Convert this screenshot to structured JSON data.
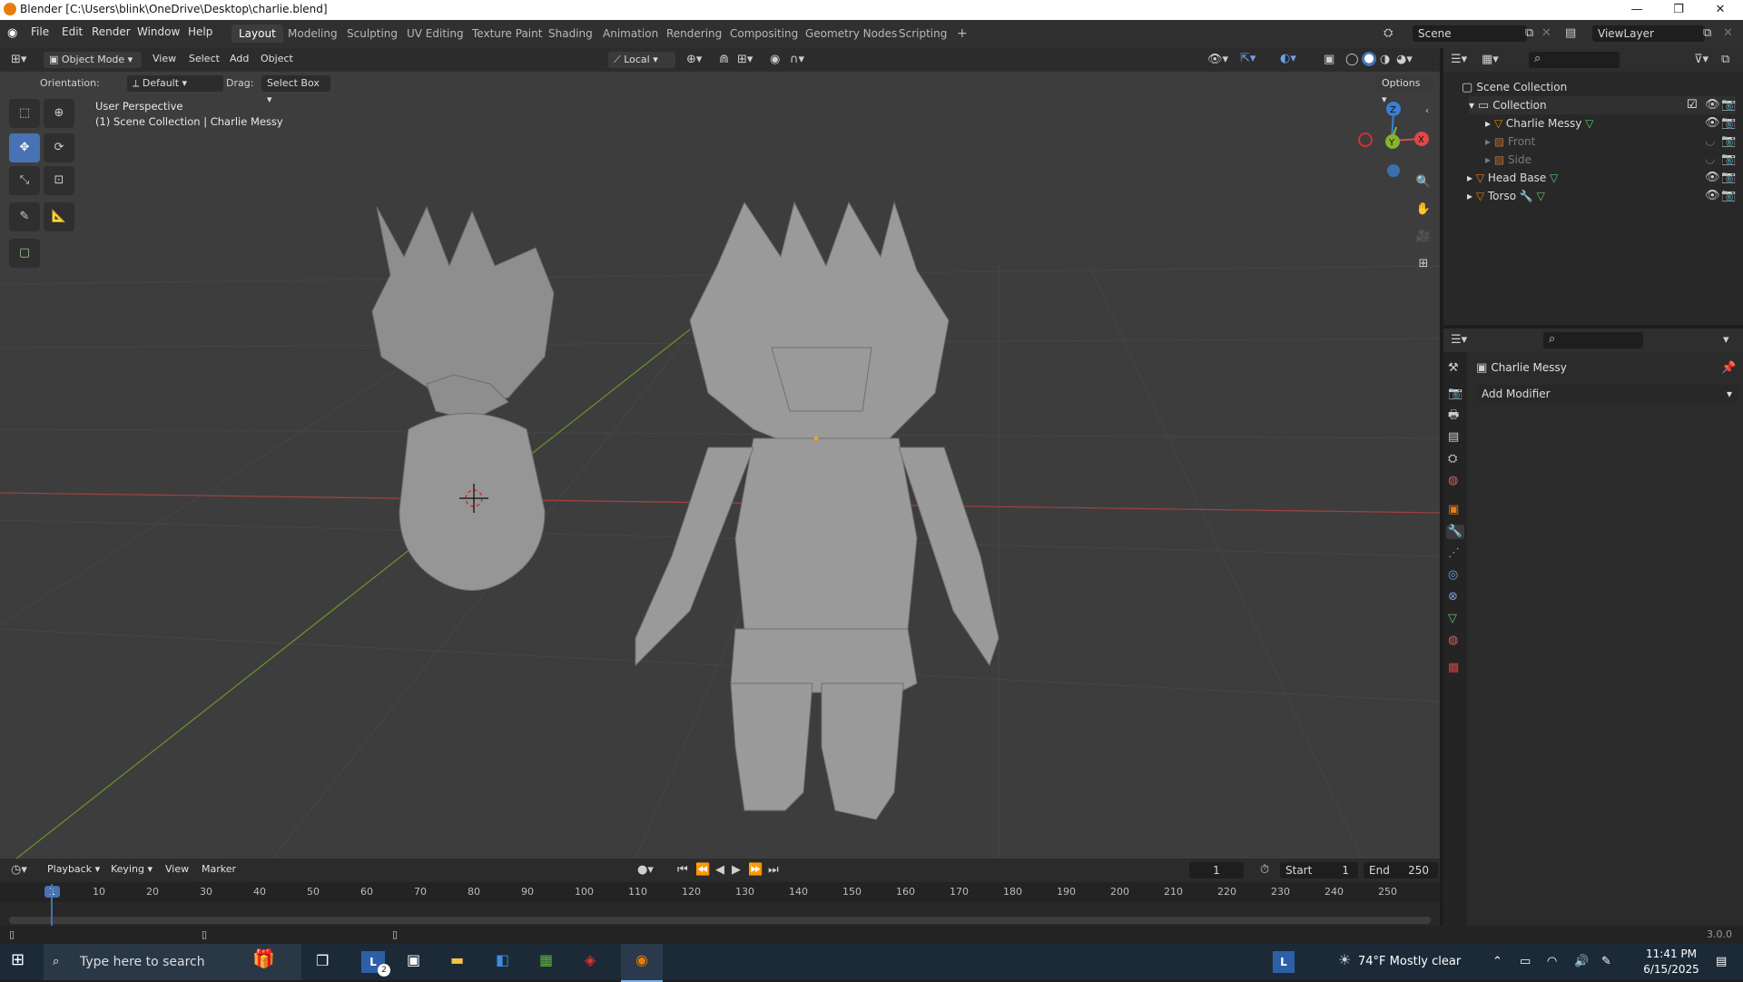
{
  "window": {
    "title": "Blender [C:\\Users\\blink\\OneDrive\\Desktop\\charlie.blend]"
  },
  "menu": [
    "File",
    "Edit",
    "Render",
    "Window",
    "Help"
  ],
  "workspaces": [
    "Layout",
    "Modeling",
    "Sculpting",
    "UV Editing",
    "Texture Paint",
    "Shading",
    "Animation",
    "Rendering",
    "Compositing",
    "Geometry Nodes",
    "Scripting",
    "+"
  ],
  "scene": {
    "name": "Scene",
    "view_layer": "ViewLayer"
  },
  "viewport_header": {
    "mode": "Object Mode",
    "menus": [
      "View",
      "Select",
      "Add",
      "Object"
    ],
    "transform_space": "Local",
    "options": "Options"
  },
  "tool_settings": {
    "orientation_label": "Orientation:",
    "orientation_value": "Default",
    "drag_label": "Drag:",
    "drag_value": "Select Box"
  },
  "overlay_text": {
    "perspective": "User Perspective",
    "collection": "(1) Scene Collection | Charlie Messy"
  },
  "gizmo": {
    "z": "Z",
    "y": "Y",
    "x": "X"
  },
  "outliner": {
    "root": "Scene Collection",
    "collection": "Collection",
    "items": [
      {
        "name": "Charlie Messy",
        "level": 2
      },
      {
        "name": "Front",
        "level": 2
      },
      {
        "name": "Side",
        "level": 2
      },
      {
        "name": "Head Base",
        "level": 1
      },
      {
        "name": "Torso",
        "level": 1
      }
    ]
  },
  "properties": {
    "object_name": "Charlie Messy",
    "add_modifier": "Add Modifier"
  },
  "timeline": {
    "menus": [
      "Playback",
      "Keying",
      "View",
      "Marker"
    ],
    "current_frame": "1",
    "start_label": "Start",
    "start_value": "1",
    "end_label": "End",
    "end_value": "250",
    "ruler": [
      "1",
      "10",
      "20",
      "30",
      "40",
      "50",
      "60",
      "70",
      "80",
      "90",
      "100",
      "110",
      "120",
      "130",
      "140",
      "150",
      "160",
      "170",
      "180",
      "190",
      "200",
      "210",
      "220",
      "230",
      "240",
      "250"
    ]
  },
  "status": {
    "version": "3.0.0"
  },
  "taskbar": {
    "search_placeholder": "Type here to search",
    "weather": "74°F  Mostly clear",
    "time": "11:41 PM",
    "date": "6/15/2025",
    "badge": "2"
  },
  "colors": {
    "accent": "#4772b3",
    "x_axis": "#e2464a",
    "y_axis": "#86b42a",
    "z_axis": "#3b7fd6",
    "orange": "#e87d0d"
  }
}
